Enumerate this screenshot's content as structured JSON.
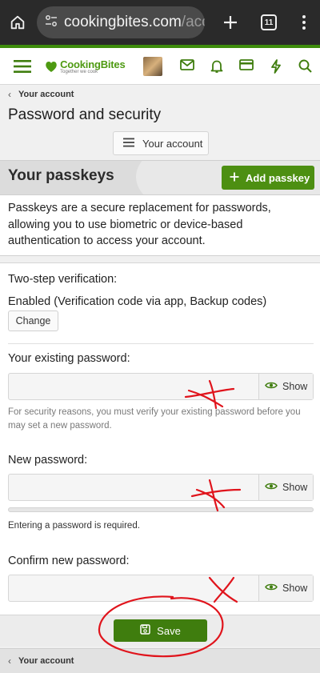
{
  "browser": {
    "url_host": "cookingbites.com",
    "url_rest": "/acc",
    "tab_count": "11"
  },
  "header": {
    "logo_text": "CookingBites",
    "logo_sub": "Together we cook"
  },
  "breadcrumb": {
    "label": "Your account"
  },
  "page": {
    "title": "Password and security",
    "account_button": "Your account"
  },
  "passkeys": {
    "title": "Your passkeys",
    "add_button": "Add passkey",
    "description": "Passkeys are a secure replacement for passwords, allowing you to use biometric or device-based authentication to access your account."
  },
  "form": {
    "two_step_label": "Two-step verification:",
    "two_step_status": "Enabled (Verification code via app, Backup codes)",
    "change_button": "Change",
    "existing_label": "Your existing password:",
    "existing_hint": "For security reasons, you must verify your existing password before you may set a new password.",
    "new_label": "New password:",
    "new_required": "Entering a password is required.",
    "confirm_label": "Confirm new password:",
    "show_label": "Show",
    "save_button": "Save"
  },
  "colors": {
    "brand_green": "#4d8f12",
    "annotation_red": "#e0141c"
  }
}
